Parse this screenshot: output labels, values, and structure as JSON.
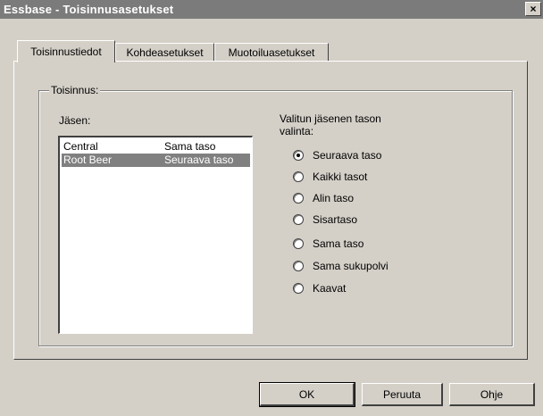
{
  "window": {
    "title": "Essbase - Toisinnusasetukset",
    "close_glyph": "×"
  },
  "tabs": [
    {
      "label": "Toisinnustiedot",
      "active": true
    },
    {
      "label": "Kohdeasetukset",
      "active": false
    },
    {
      "label": "Muotoiluasetukset",
      "active": false
    }
  ],
  "group": {
    "label": "Toisinnus:"
  },
  "members": {
    "label": "Jäsen:",
    "rows": [
      {
        "member": "Central",
        "level": "Sama taso",
        "selected": false
      },
      {
        "member": "Root Beer",
        "level": "Seuraava taso",
        "selected": true
      }
    ]
  },
  "level_choice": {
    "label_line1": "Valitun jäsenen tason",
    "label_line2": "valinta:",
    "options": [
      {
        "label": "Seuraava taso",
        "checked": true
      },
      {
        "label": "Kaikki tasot",
        "checked": false
      },
      {
        "label": "Alin taso",
        "checked": false
      },
      {
        "label": "Sisartaso",
        "checked": false
      },
      {
        "label": "Sama taso",
        "checked": false
      },
      {
        "label": "Sama sukupolvi",
        "checked": false
      },
      {
        "label": "Kaavat",
        "checked": false
      }
    ]
  },
  "buttons": {
    "ok": "OK",
    "cancel": "Peruuta",
    "help": "Ohje"
  }
}
